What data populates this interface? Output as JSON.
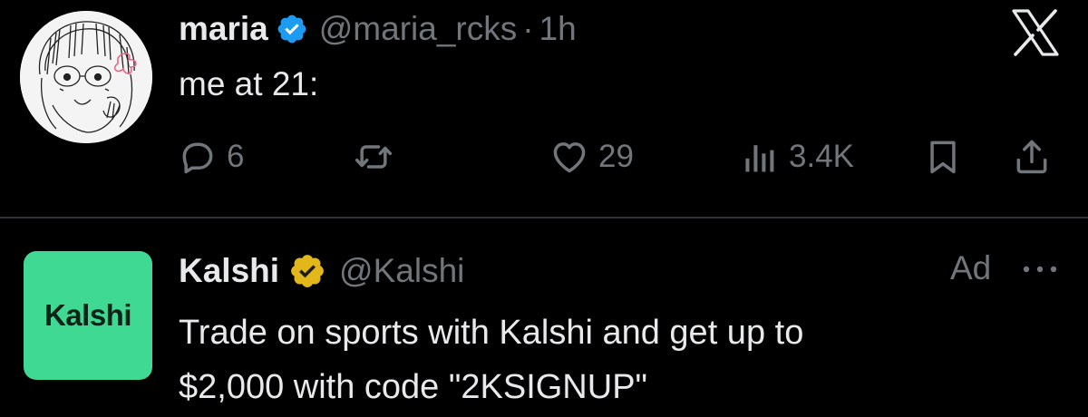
{
  "post": {
    "author_name": "maria",
    "handle": "@maria_rcks",
    "separator": "·",
    "time": "1h",
    "text": "me at 21:",
    "verified_icon": "verified-badge-blue-icon",
    "avatar_icon": "sketch-avatar",
    "actions": {
      "replies": "6",
      "reposts": "",
      "likes": "29",
      "views": "3.4K"
    }
  },
  "top_right_icon": "x-logo-icon",
  "ad": {
    "brand_logo_text": "Kalshi",
    "author_name": "Kalshi",
    "handle": "@Kalshi",
    "ad_label": "Ad",
    "verified_icon": "verified-badge-gold-icon",
    "text_line1": "Trade on sports with Kalshi and get up to",
    "text_line2": "$2,000 with code \"2KSIGNUP\""
  },
  "colors": {
    "background": "#000000",
    "text_primary": "#e7e9ea",
    "text_secondary": "#71767b",
    "verified_blue": "#1d9bf0",
    "verified_gold": "#e2b719",
    "kalshi_green": "#3fd993",
    "divider": "#2f3336"
  }
}
